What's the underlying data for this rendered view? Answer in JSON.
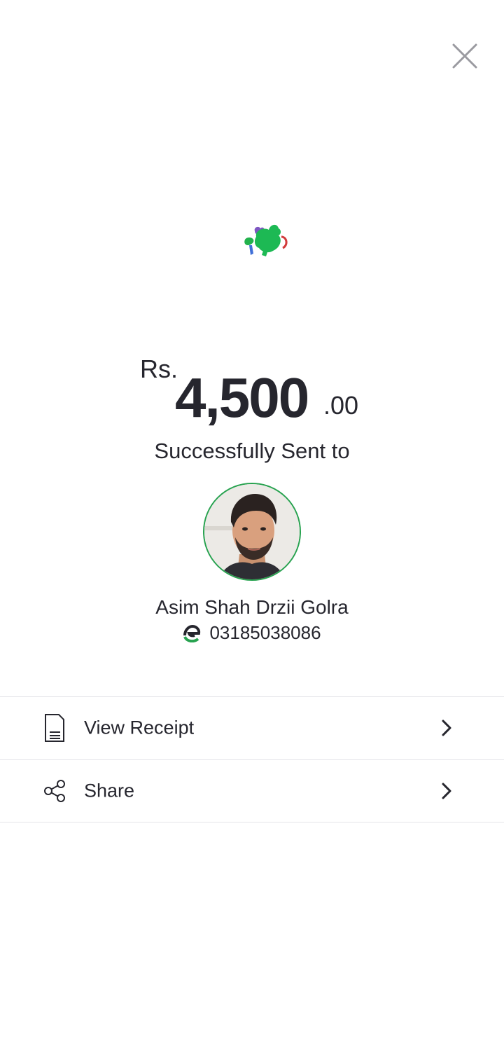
{
  "header": {
    "close_icon": "close-icon"
  },
  "brand": {
    "icon": "brand-logo-icon",
    "colors": [
      "#1db954",
      "#7e57c2",
      "#3f6fd8",
      "#d23b3b"
    ]
  },
  "transaction": {
    "currency": "Rs.",
    "amount_major": "4,500",
    "amount_minor": ".00",
    "status_text": "Successfully Sent to"
  },
  "recipient": {
    "avatar_icon": "user-avatar",
    "name": "Asim Shah Drzii Golra",
    "phone": "03185038086",
    "wallet_icon": "easypaisa-icon"
  },
  "actions": [
    {
      "label": "View Receipt",
      "icon": "receipt-icon",
      "chevron": "chevron-right-icon"
    },
    {
      "label": "Share",
      "icon": "share-icon",
      "chevron": "chevron-right-icon"
    }
  ],
  "colors": {
    "text": "#26262e",
    "accent_green": "#27a24f",
    "divider": "#e4e4e8",
    "close_gray": "#9a9aa0"
  }
}
